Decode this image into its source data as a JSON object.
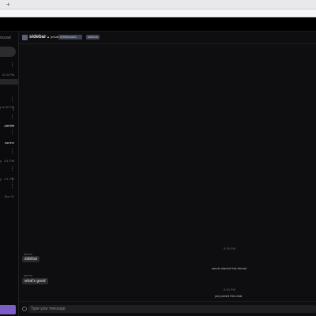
{
  "browser": {
    "new_tab_glyph": "+"
  },
  "sidebar": {
    "brand_fragment": "ocuad",
    "items": [
      {
        "meta": "9:13 PM"
      },
      {
        "meta": "3"
      },
      {
        "meta": "6:32 PM"
      },
      {
        "meta": "sas MA"
      },
      {
        "label": "sanhal"
      },
      {
        "label": "samhe"
      },
      {
        "meta": "4:1 PM"
      },
      {
        "meta": "4:1 PM"
      },
      {
        "meta": "Nov 11"
      }
    ],
    "left_fragments": [
      "p",
      "p",
      "p"
    ]
  },
  "channel": {
    "title": "sidebar",
    "lock_glyph": "▲",
    "tags": [
      "private",
      "Whiteboard",
      "sidebar"
    ]
  },
  "messages": [
    {
      "author": "aarvin",
      "text": "sidebar"
    },
    {
      "author": "aarvin",
      "text": "what's good"
    }
  ],
  "system_events": [
    {
      "time": "9:35 PM",
      "text": "aarvin started this thread"
    },
    {
      "time": "9:16 PM",
      "text": "you joined this chat"
    }
  ],
  "composer": {
    "placeholder": "Type your message"
  },
  "colors": {
    "accent": "#7b5cc8",
    "background": "#0e0e10",
    "bubble": "#2a2a2f"
  }
}
